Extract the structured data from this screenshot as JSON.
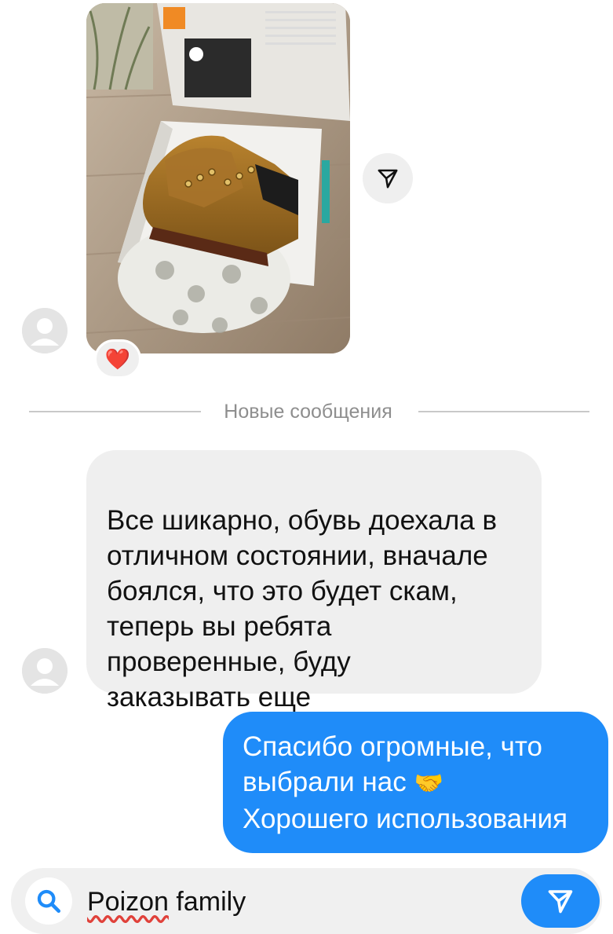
{
  "thread": {
    "shared_photo": {
      "description_icon": "photo-boots-in-box",
      "reaction": "❤️"
    },
    "divider_label": "Новые сообщения",
    "incoming_message": {
      "text": "Все шикарно, обувь доехала в\nотличном состоянии, вначале\nбоялся, что это будет скам,\nтеперь вы ребята\nпроверенные, буду\nзаказывать еще"
    },
    "outgoing_message": {
      "line1": "Спасибо огромные, что",
      "line2": "выбрали нас",
      "emoji": "🤝",
      "line3": "Хорошего использования"
    }
  },
  "composer": {
    "typed_misspelled": "Poizon",
    "typed_rest": " family",
    "search_icon": "search-icon",
    "send_icon": "send-icon"
  },
  "colors": {
    "accent_blue": "#1f8cf9",
    "incoming_bubble": "#efefef",
    "divider_text": "#8e8e8e",
    "heart": "#ff2d55"
  }
}
